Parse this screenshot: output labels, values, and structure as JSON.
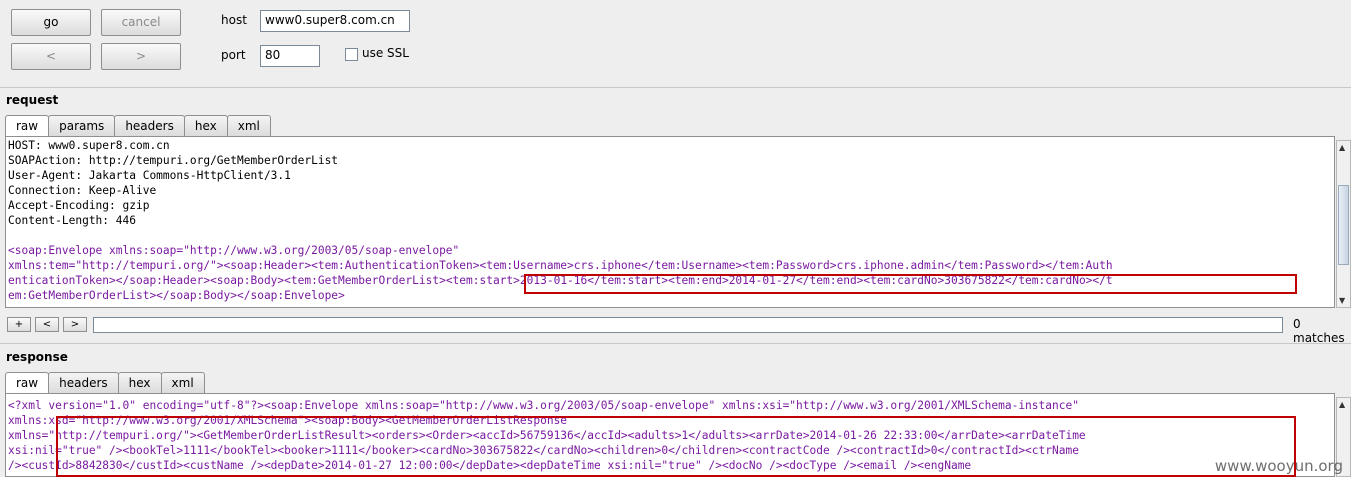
{
  "toolbar": {
    "go_label": "go",
    "cancel_label": "cancel",
    "back_label": "<",
    "forward_label": ">",
    "host_label": "host",
    "host_value": "www0.super8.com.cn",
    "port_label": "port",
    "port_value": "80",
    "ssl_label": "use SSL"
  },
  "request": {
    "title": "request",
    "tabs": [
      "raw",
      "params",
      "headers",
      "hex",
      "xml"
    ],
    "headers": [
      "HOST: www0.super8.com.cn",
      "SOAPAction: http://tempuri.org/GetMemberOrderList",
      "User-Agent: Jakarta Commons-HttpClient/3.1",
      "Connection: Keep-Alive",
      "Accept-Encoding: gzip",
      "Content-Length: 446"
    ],
    "body_line1": "<soap:Envelope xmlns:soap=\"http://www.w3.org/2003/05/soap-envelope\"",
    "body_line2": "xmlns:tem=\"http://tempuri.org/\"><soap:Header><tem:AuthenticationToken><tem:Username>crs.iphone</tem:Username><tem:Password>crs.iphone.admin</tem:Password></tem:Auth",
    "body_line3_a": "enticationToken></soap:Header><soap:Body><tem:GetMemberOrderList>",
    "body_line3_b": "<tem:start>2013-01-16</tem:start><tem:end>2014-01-27</tem:end><tem:cardNo>303675822</tem:cardNo>",
    "body_line3_c": "</t",
    "body_line4": "em:GetMemberOrderList></soap:Body></soap:Envelope>",
    "search": {
      "plus": "+",
      "prev": "<",
      "next": ">",
      "matches": "0 matches"
    }
  },
  "response": {
    "title": "response",
    "tabs": [
      "raw",
      "headers",
      "hex",
      "xml"
    ],
    "line1": "<?xml version=\"1.0\" encoding=\"utf-8\"?><soap:Envelope xmlns:soap=\"http://www.w3.org/2003/05/soap-envelope\" xmlns:xsi=\"http://www.w3.org/2001/XMLSchema-instance\"",
    "line2": "xmlns:xsd=\"http://www.w3.org/2001/XMLSchema\"><soap:Body><GetMemberOrderListResponse",
    "line3": "xmlns=\"http://tempuri.org/\"><GetMemberOrderListResult><orders><Order><accId>56759136</accId><adults>1</adults><arrDate>2014-01-26 22:33:00</arrDate><arrDateTime",
    "line4": "xsi:nil=\"true\" /><bookTel>1111</bookTel><booker>1111</booker><cardNo>303675822</cardNo><children>0</children><contractCode /><contractId>0</contractId><ctrName",
    "line5": "/><custId>8842830</custId><custName /><depDate>2014-01-27 12:00:00</depDate><depDateTime xsi:nil=\"true\" /><docNo /><docType /><email /><engName"
  },
  "watermark": "www.wooyun.org"
}
